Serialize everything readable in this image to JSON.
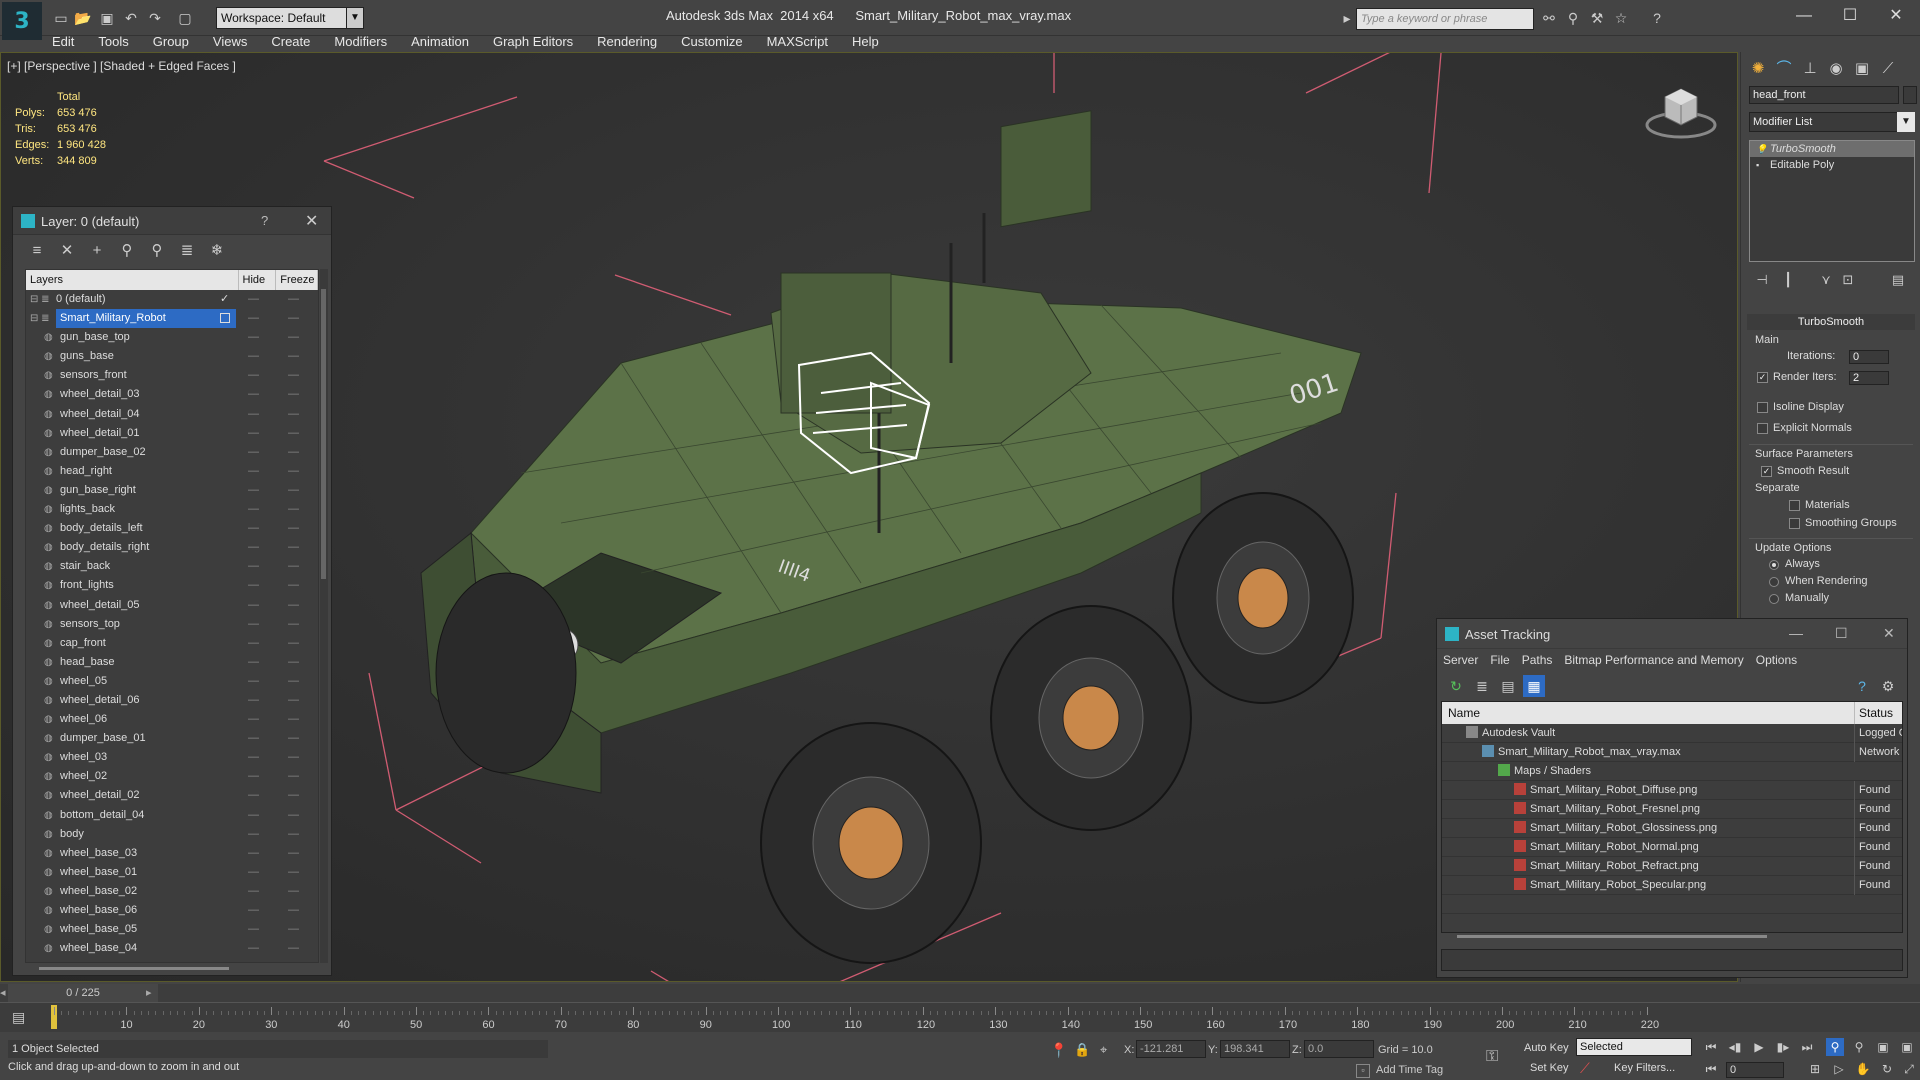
{
  "app": {
    "title": "Autodesk 3ds Max  2014 x64      Smart_Military_Robot_max_vray.max",
    "logo": "3",
    "workspace": "Workspace: Default",
    "search_placeholder": "Type a keyword or phrase"
  },
  "menu": [
    "Edit",
    "Tools",
    "Group",
    "Views",
    "Create",
    "Modifiers",
    "Animation",
    "Graph Editors",
    "Rendering",
    "Customize",
    "MAXScript",
    "Help"
  ],
  "viewport": {
    "label": "[+] [Perspective ] [Shaded + Edged Faces ]",
    "stats": {
      "header": "Total",
      "rows": [
        {
          "k": "Polys:",
          "v": "653 476"
        },
        {
          "k": "Tris:",
          "v": "653 476"
        },
        {
          "k": "Edges:",
          "v": "1 960 428"
        },
        {
          "k": "Verts:",
          "v": "344 809"
        }
      ]
    }
  },
  "layer_dialog": {
    "title": "Layer: 0 (default)",
    "help": "?",
    "col_layers": "Layers",
    "col_hide": "Hide",
    "col_freeze": "Freeze",
    "rows": [
      "0 (default)",
      "Smart_Military_Robot",
      "gun_base_top",
      "guns_base",
      "sensors_front",
      "wheel_detail_03",
      "wheel_detail_04",
      "wheel_detail_01",
      "dumper_base_02",
      "head_right",
      "gun_base_right",
      "lights_back",
      "body_details_left",
      "body_details_right",
      "stair_back",
      "front_lights",
      "wheel_detail_05",
      "sensors_top",
      "cap_front",
      "head_base",
      "wheel_05",
      "wheel_detail_06",
      "wheel_06",
      "dumper_base_01",
      "wheel_03",
      "wheel_02",
      "wheel_detail_02",
      "bottom_detail_04",
      "body",
      "wheel_base_03",
      "wheel_base_01",
      "wheel_base_02",
      "wheel_base_06",
      "wheel_base_05",
      "wheel_base_04"
    ]
  },
  "command_panel": {
    "object_name": "head_front",
    "modifier_list": "Modifier List",
    "stack": [
      "TurboSmooth",
      "Editable Poly"
    ],
    "turbosmooth": {
      "title": "TurboSmooth",
      "main": "Main",
      "iterations_label": "Iterations:",
      "iterations": "0",
      "render_iters_label": "Render Iters:",
      "render_iters": "2",
      "isoline": "Isoline Display",
      "explicit_normals": "Explicit Normals",
      "surface_params": "Surface Parameters",
      "smooth_result": "Smooth Result",
      "separate": "Separate",
      "materials": "Materials",
      "smoothing_groups": "Smoothing Groups",
      "update_options": "Update Options",
      "always": "Always",
      "when_rendering": "When Rendering",
      "manually": "Manually"
    }
  },
  "asset_tracking": {
    "title": "Asset Tracking",
    "menu": [
      "Server",
      "File",
      "Paths",
      "Bitmap Performance and Memory",
      "Options"
    ],
    "col_name": "Name",
    "col_status": "Status",
    "rows": [
      {
        "name": "Autodesk Vault",
        "status": "Logged O",
        "icon": "vault",
        "indent": 1
      },
      {
        "name": "Smart_Military_Robot_max_vray.max",
        "status": "Network",
        "icon": "max",
        "indent": 2
      },
      {
        "name": "Maps / Shaders",
        "status": "",
        "icon": "folder",
        "indent": 3
      },
      {
        "name": "Smart_Military_Robot_Diffuse.png",
        "status": "Found",
        "icon": "png",
        "indent": 4
      },
      {
        "name": "Smart_Military_Robot_Fresnel.png",
        "status": "Found",
        "icon": "png",
        "indent": 4
      },
      {
        "name": "Smart_Military_Robot_Glossiness.png",
        "status": "Found",
        "icon": "png",
        "indent": 4
      },
      {
        "name": "Smart_Military_Robot_Normal.png",
        "status": "Found",
        "icon": "png",
        "indent": 4
      },
      {
        "name": "Smart_Military_Robot_Refract.png",
        "status": "Found",
        "icon": "png",
        "indent": 4
      },
      {
        "name": "Smart_Military_Robot_Specular.png",
        "status": "Found",
        "icon": "png",
        "indent": 4
      }
    ]
  },
  "timeline": {
    "frame_counter": "0 / 225",
    "ticks": [
      "0",
      "10",
      "20",
      "30",
      "40",
      "50",
      "60",
      "70",
      "80",
      "90",
      "100",
      "110",
      "120",
      "130",
      "140",
      "150",
      "160",
      "170",
      "180",
      "190",
      "200",
      "210",
      "220"
    ]
  },
  "status": {
    "selection": "1 Object Selected",
    "hint": "Click and drag up-and-down to zoom in and out",
    "x_label": "X:",
    "x": "-121.281",
    "y_label": "Y:",
    "y": "198.341",
    "z_label": "Z:",
    "z": "0.0",
    "grid": "Grid = 10.0",
    "add_time_tag": "Add Time Tag",
    "auto_key": "Auto Key",
    "set_key": "Set Key",
    "selected": "Selected",
    "key_filters": "Key Filters...",
    "frame": "0"
  }
}
